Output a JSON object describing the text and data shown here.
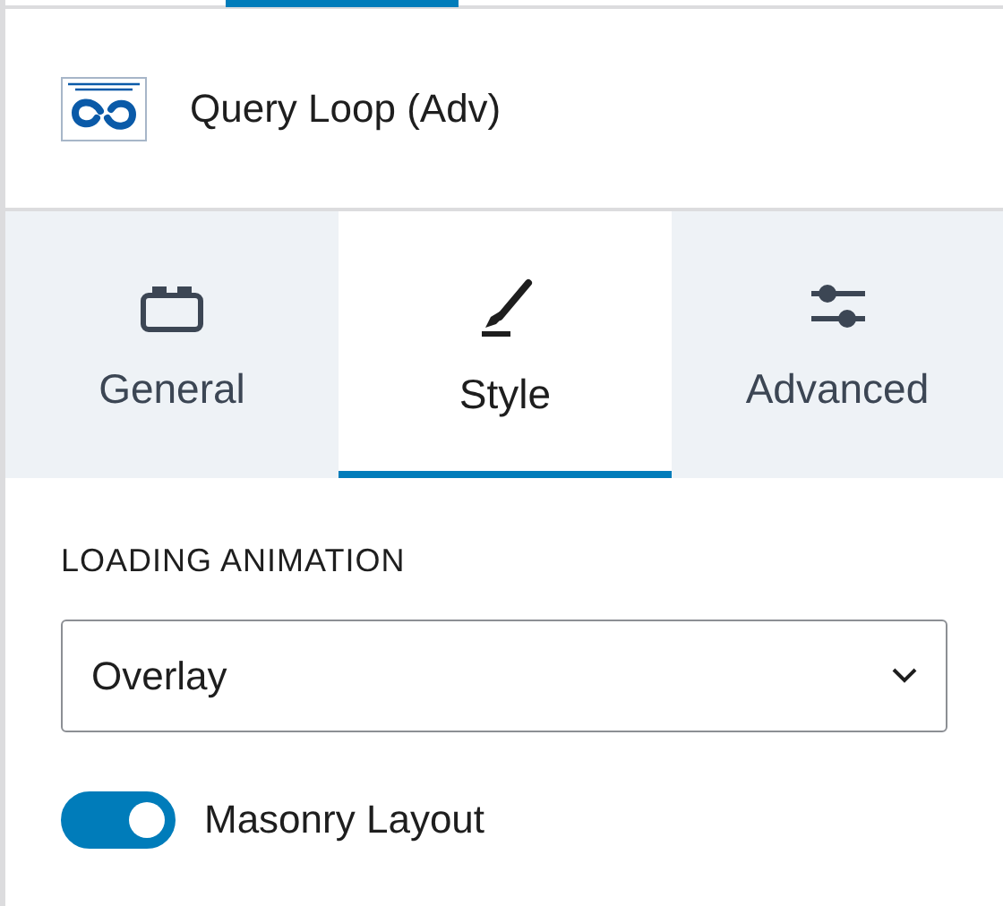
{
  "block": {
    "title": "Query Loop (Adv)"
  },
  "tabs": [
    {
      "label": "General",
      "kind": "general",
      "selected": false
    },
    {
      "label": "Style",
      "kind": "style",
      "selected": true
    },
    {
      "label": "Advanced",
      "kind": "advanced",
      "selected": false
    }
  ],
  "loading_animation": {
    "label": "LOADING ANIMATION",
    "value": "Overlay"
  },
  "masonry": {
    "label": "Masonry Layout",
    "on": true
  }
}
